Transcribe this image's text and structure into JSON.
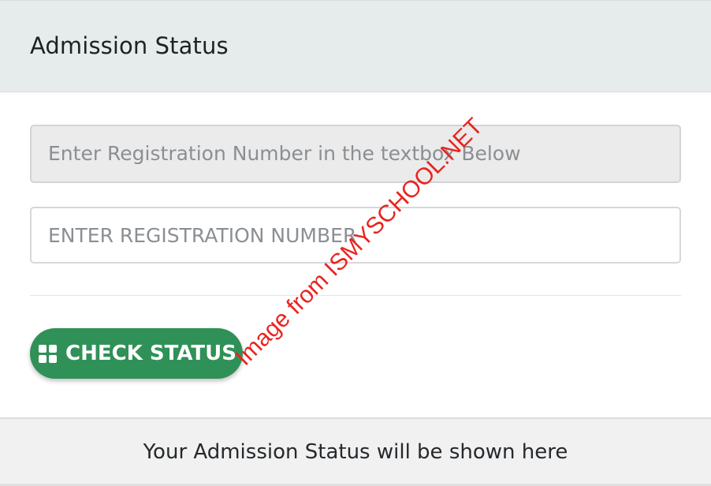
{
  "panel": {
    "title": "Admission Status"
  },
  "form": {
    "info_text": "Enter Registration Number in the textbox Below",
    "registration_placeholder": "ENTER REGISTRATION NUMBER",
    "registration_value": "",
    "check_button_label": "CHECK STATUS",
    "check_button_icon": "th-large-icon"
  },
  "result": {
    "message": "Your Admission Status will be shown here"
  },
  "watermark": {
    "text": "Image from ISMYSCHOOL.NET"
  },
  "colors": {
    "header_bg": "#e6ebec",
    "button_green": "#2f9158",
    "watermark_red": "#e8251f"
  }
}
